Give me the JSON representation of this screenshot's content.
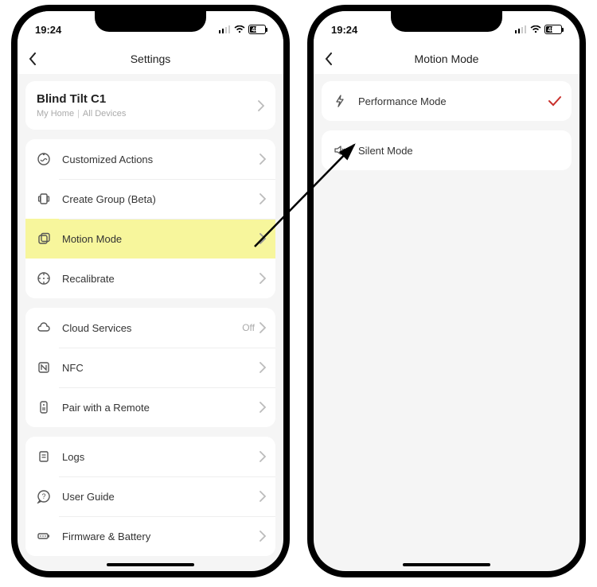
{
  "status": {
    "time": "19:24",
    "battery": "48"
  },
  "left": {
    "title": "Settings",
    "device": {
      "name": "Blind Tilt C1",
      "home": "My Home",
      "group": "All Devices"
    },
    "group1": [
      {
        "icon": "actions-icon",
        "label": "Customized Actions"
      },
      {
        "icon": "group-icon",
        "label": "Create Group (Beta)"
      },
      {
        "icon": "motion-icon",
        "label": "Motion Mode",
        "highlight": true
      },
      {
        "icon": "recal-icon",
        "label": "Recalibrate"
      }
    ],
    "group2": [
      {
        "icon": "cloud-icon",
        "label": "Cloud Services",
        "meta": "Off"
      },
      {
        "icon": "nfc-icon",
        "label": "NFC"
      },
      {
        "icon": "remote-icon",
        "label": "Pair with a Remote"
      }
    ],
    "group3": [
      {
        "icon": "logs-icon",
        "label": "Logs"
      },
      {
        "icon": "help-icon",
        "label": "User Guide"
      },
      {
        "icon": "battery-icon",
        "label": "Firmware & Battery"
      }
    ]
  },
  "right": {
    "title": "Motion Mode",
    "options": [
      {
        "icon": "bolt-icon",
        "label": "Performance Mode",
        "selected": true
      },
      {
        "icon": "mute-icon",
        "label": "Silent Mode",
        "selected": false
      }
    ]
  }
}
